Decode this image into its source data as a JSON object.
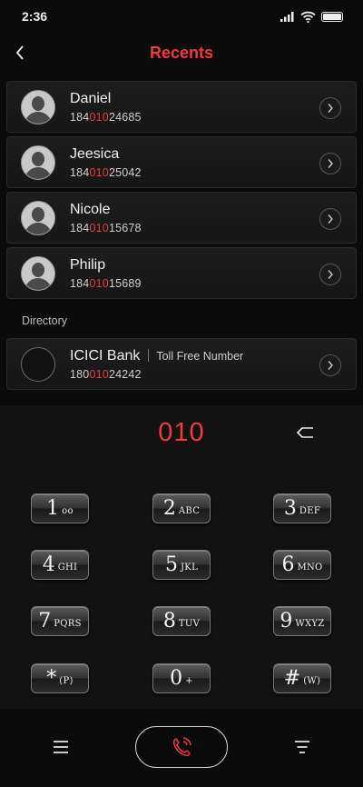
{
  "status": {
    "time": "2:36"
  },
  "header": {
    "title": "Recents"
  },
  "contacts": [
    {
      "name": "Daniel",
      "num_pre": "184",
      "num_hl": "010",
      "num_post": "24685"
    },
    {
      "name": "Jeesica",
      "num_pre": "184",
      "num_hl": "010",
      "num_post": "25042"
    },
    {
      "name": "Nicole",
      "num_pre": "184",
      "num_hl": "010",
      "num_post": "15678"
    },
    {
      "name": "Philip",
      "num_pre": "184",
      "num_hl": "010",
      "num_post": "15689"
    }
  ],
  "directory": {
    "label": "Directory",
    "entry": {
      "name": "ICICI Bank",
      "tag": "Toll Free Number",
      "num_pre": "180",
      "num_hl": "010",
      "num_post": "24242"
    }
  },
  "dialpad": {
    "dialed": "010",
    "keys": [
      {
        "digit": "1",
        "letters": "oo"
      },
      {
        "digit": "2",
        "letters": "ABC"
      },
      {
        "digit": "3",
        "letters": "DEF"
      },
      {
        "digit": "4",
        "letters": "GHI"
      },
      {
        "digit": "5",
        "letters": "JKL"
      },
      {
        "digit": "6",
        "letters": "MNO"
      },
      {
        "digit": "7",
        "letters": "PQRS"
      },
      {
        "digit": "8",
        "letters": "TUV"
      },
      {
        "digit": "9",
        "letters": "WXYZ"
      },
      {
        "digit": "*",
        "letters": "(P)"
      },
      {
        "digit": "0",
        "letters": "+"
      },
      {
        "digit": "#",
        "letters": "(W)"
      }
    ]
  },
  "colors": {
    "accent": "#ef3a3f",
    "background": "#0b0b0b"
  },
  "icons": {
    "back": "chevron-left-icon",
    "chevron": "chevron-right-icon",
    "backspace": "backspace-icon",
    "menu": "menu-icon",
    "filter": "filter-icon",
    "call": "phone-icon"
  }
}
